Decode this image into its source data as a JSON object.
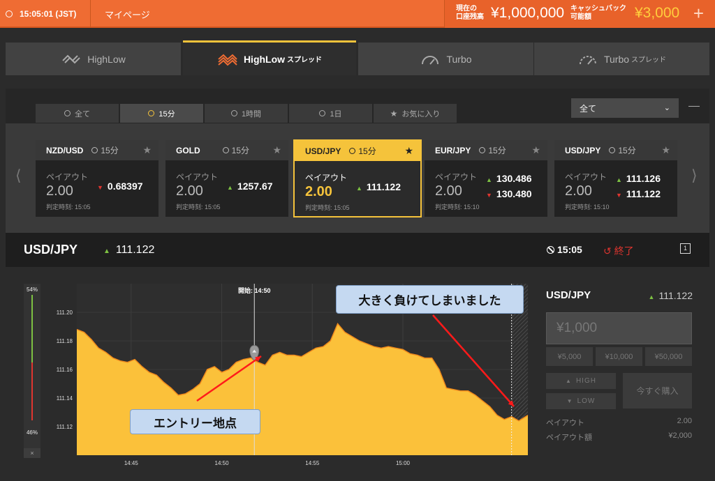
{
  "topbar": {
    "time": "15:05:01 (JST)",
    "mypage": "マイページ",
    "balance_label_1": "現在の",
    "balance_label_2": "口座残高",
    "balance_value": "¥1,000,000",
    "cashback_label_1": "キャッシュバック",
    "cashback_label_2": "可能額",
    "cashback_value": "¥3,000",
    "plus": "+"
  },
  "product_tabs": [
    {
      "label": "HighLow",
      "suffix": ""
    },
    {
      "label": "HighLow",
      "suffix": "スプレッド"
    },
    {
      "label": "Turbo",
      "suffix": ""
    },
    {
      "label": "Turbo",
      "suffix": "スプレッド"
    }
  ],
  "filter_tabs": [
    "全て",
    "15分",
    "1時間",
    "1日",
    "お気に入り"
  ],
  "dropdown": {
    "value": "全て"
  },
  "cards": [
    {
      "asset": "NZD/USD",
      "duration": "15分",
      "payout_label": "ペイアウト",
      "payout": "2.00",
      "rate1": "0.68397",
      "rate1_dir": "down",
      "rate2": "",
      "judge": "判定時刻: 15:05"
    },
    {
      "asset": "GOLD",
      "duration": "15分",
      "payout_label": "ペイアウト",
      "payout": "2.00",
      "rate1": "1257.67",
      "rate1_dir": "up",
      "rate2": "",
      "judge": "判定時刻: 15:05"
    },
    {
      "asset": "USD/JPY",
      "duration": "15分",
      "payout_label": "ペイアウト",
      "payout": "2.00",
      "rate1": "111.122",
      "rate1_dir": "up",
      "rate2": "",
      "judge": "判定時刻: 15:05"
    },
    {
      "asset": "EUR/JPY",
      "duration": "15分",
      "payout_label": "ペイアウト",
      "payout": "2.00",
      "rate1": "130.486",
      "rate1_dir": "up",
      "rate2": "130.480",
      "judge": "判定時刻: 15:10"
    },
    {
      "asset": "USD/JPY",
      "duration": "15分",
      "payout_label": "ペイアウト",
      "payout": "2.00",
      "rate1": "111.126",
      "rate1_dir": "up",
      "rate2": "111.122",
      "judge": "判定時刻: 15:10"
    }
  ],
  "asset_bar": {
    "name": "USD/JPY",
    "price": "111.122",
    "time": "15:05",
    "end": "終了"
  },
  "sentiment": {
    "high": "54%",
    "low": "46%",
    "high_value": 0.54,
    "close": "×"
  },
  "chart_data": {
    "type": "area",
    "title": "",
    "xlabel": "",
    "ylabel": "",
    "x_ticks": [
      "14:45",
      "14:50",
      "14:55",
      "15:00"
    ],
    "y_ticks": [
      "111.20",
      "111.18",
      "111.16",
      "111.14",
      "111.12"
    ],
    "ylim": [
      111.1,
      111.22
    ],
    "x_range_minutes": [
      0,
      24.9
    ],
    "start_marker": {
      "label": "開始: 14:50",
      "x": 9.8
    },
    "entry_point": {
      "x": 9.8,
      "y": 111.167
    },
    "series": [
      {
        "x": [
          0,
          0.4,
          0.8,
          1.2,
          1.6,
          2.0,
          2.4,
          2.8,
          3.2,
          3.6,
          4.0,
          4.4,
          4.8,
          5.2,
          5.6,
          6.0,
          6.4,
          6.8,
          7.2,
          7.6,
          8.0,
          8.4,
          8.8,
          9.2,
          9.6,
          10.0,
          10.4,
          10.8,
          11.2,
          11.6,
          12.0,
          12.4,
          12.8,
          13.2,
          13.6,
          14.0,
          14.4,
          14.8,
          15.2,
          15.6,
          16.0,
          16.4,
          16.8,
          17.2,
          17.6,
          18.0,
          18.4,
          18.8,
          19.2,
          19.6,
          20.0,
          20.4,
          20.8,
          21.2,
          21.6,
          22.0,
          22.4,
          22.8,
          23.2,
          23.6,
          24.0,
          24.4,
          24.9
        ],
        "y": [
          111.188,
          111.186,
          111.181,
          111.175,
          111.172,
          111.168,
          111.166,
          111.165,
          111.167,
          111.162,
          111.158,
          111.156,
          111.151,
          111.147,
          111.142,
          111.143,
          111.146,
          111.15,
          111.16,
          111.162,
          111.158,
          111.16,
          111.165,
          111.167,
          111.168,
          111.165,
          111.163,
          111.17,
          111.172,
          111.17,
          111.17,
          111.169,
          111.172,
          111.175,
          111.176,
          111.18,
          111.192,
          111.186,
          111.183,
          111.18,
          111.178,
          111.176,
          111.175,
          111.176,
          111.175,
          111.174,
          111.171,
          111.17,
          111.168,
          111.168,
          111.16,
          111.147,
          111.146,
          111.145,
          111.145,
          111.142,
          111.138,
          111.134,
          111.128,
          111.125,
          111.127,
          111.124,
          111.128
        ]
      }
    ]
  },
  "callouts": {
    "entry": "エントリー地点",
    "loss": "大きく負けてしまいました"
  },
  "trade_panel": {
    "asset": "USD/JPY",
    "price": "111.122",
    "amount_placeholder": "¥1,000",
    "quick": [
      "¥5,000",
      "¥10,000",
      "¥50,000"
    ],
    "high": "HIGH",
    "low": "LOW",
    "buy": "今すぐ購入",
    "payout_label": "ペイアウト",
    "payout_value": "2.00",
    "payout_amount_label": "ペイアウト額",
    "payout_amount_value": "¥2,000"
  },
  "colors": {
    "accent": "#ef6c33",
    "highlight": "#f5c33b",
    "area": "#fbc13a",
    "up": "#7dc142",
    "down": "#e0352f"
  }
}
